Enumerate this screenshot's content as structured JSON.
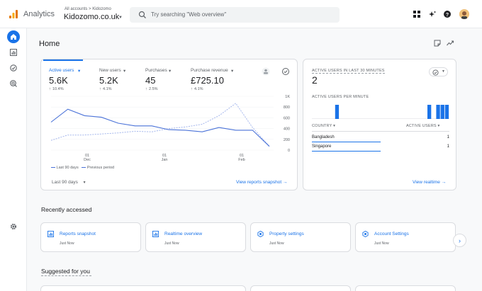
{
  "header": {
    "app_name": "Analytics",
    "account_crumb": "All accounts > Kidozomo",
    "property_name": "Kidozomo.co.uk",
    "search_placeholder": "Try searching \"Web overview\""
  },
  "page": {
    "title": "Home"
  },
  "overview": {
    "metrics": [
      {
        "label": "Active users",
        "value": "5.6K",
        "change": "10.4%",
        "active": true
      },
      {
        "label": "New users",
        "value": "5.2K",
        "change": "4.1%"
      },
      {
        "label": "Purchases",
        "value": "45",
        "change": "2.5%"
      },
      {
        "label": "Purchase revenue",
        "value": "£725.10",
        "change": "4.1%"
      }
    ],
    "legend_current": "Last 90 days",
    "legend_previous": "Previous period",
    "date_range": "Last 90 days",
    "link": "View reports snapshot"
  },
  "chart_data": {
    "type": "line",
    "y_ticks": [
      "1K",
      "800",
      "600",
      "400",
      "200",
      "0"
    ],
    "x_ticks": [
      {
        "day": "01",
        "month": "Dec"
      },
      {
        "day": "01",
        "month": "Jan"
      },
      {
        "day": "01",
        "month": "Feb"
      }
    ],
    "ylim": [
      0,
      1000
    ],
    "series": [
      {
        "name": "Last 90 days",
        "values": [
          520,
          760,
          640,
          610,
          500,
          450,
          450,
          380,
          370,
          340,
          420,
          370,
          370,
          70
        ]
      },
      {
        "name": "Previous period",
        "values": [
          180,
          280,
          280,
          300,
          320,
          350,
          340,
          400,
          430,
          480,
          640,
          870,
          420,
          70
        ]
      }
    ],
    "colors": {
      "current": "#4a72d8",
      "previous": "#a4b6ec"
    }
  },
  "realtime": {
    "title": "ACTIVE USERS IN LAST 30 MINUTES",
    "value": "2",
    "per_minute_label": "ACTIVE USERS PER MINUTE",
    "per_minute": [
      0,
      0,
      0,
      0,
      1,
      0,
      0,
      0,
      0,
      0,
      0,
      0,
      0,
      0,
      0,
      0,
      0,
      0,
      0,
      0,
      0,
      0,
      0,
      0,
      0,
      1,
      0,
      1,
      1,
      1
    ],
    "col_country": "COUNTRY",
    "col_users": "ACTIVE USERS",
    "rows": [
      {
        "country": "Bangladesh",
        "users": "1"
      },
      {
        "country": "Singapore",
        "users": "1"
      }
    ],
    "link": "View realtime"
  },
  "recent": {
    "title": "Recently accessed",
    "items": [
      {
        "title": "Reports snapshot",
        "sub": "Just Now",
        "icon": "reports-icon"
      },
      {
        "title": "Realtime overview",
        "sub": "Just Now",
        "icon": "reports-icon"
      },
      {
        "title": "Property settings",
        "sub": "Just Now",
        "icon": "settings-icon"
      },
      {
        "title": "Account Settings",
        "sub": "Just Now",
        "icon": "settings-icon"
      }
    ]
  },
  "suggested": {
    "title": "Suggested for you"
  }
}
